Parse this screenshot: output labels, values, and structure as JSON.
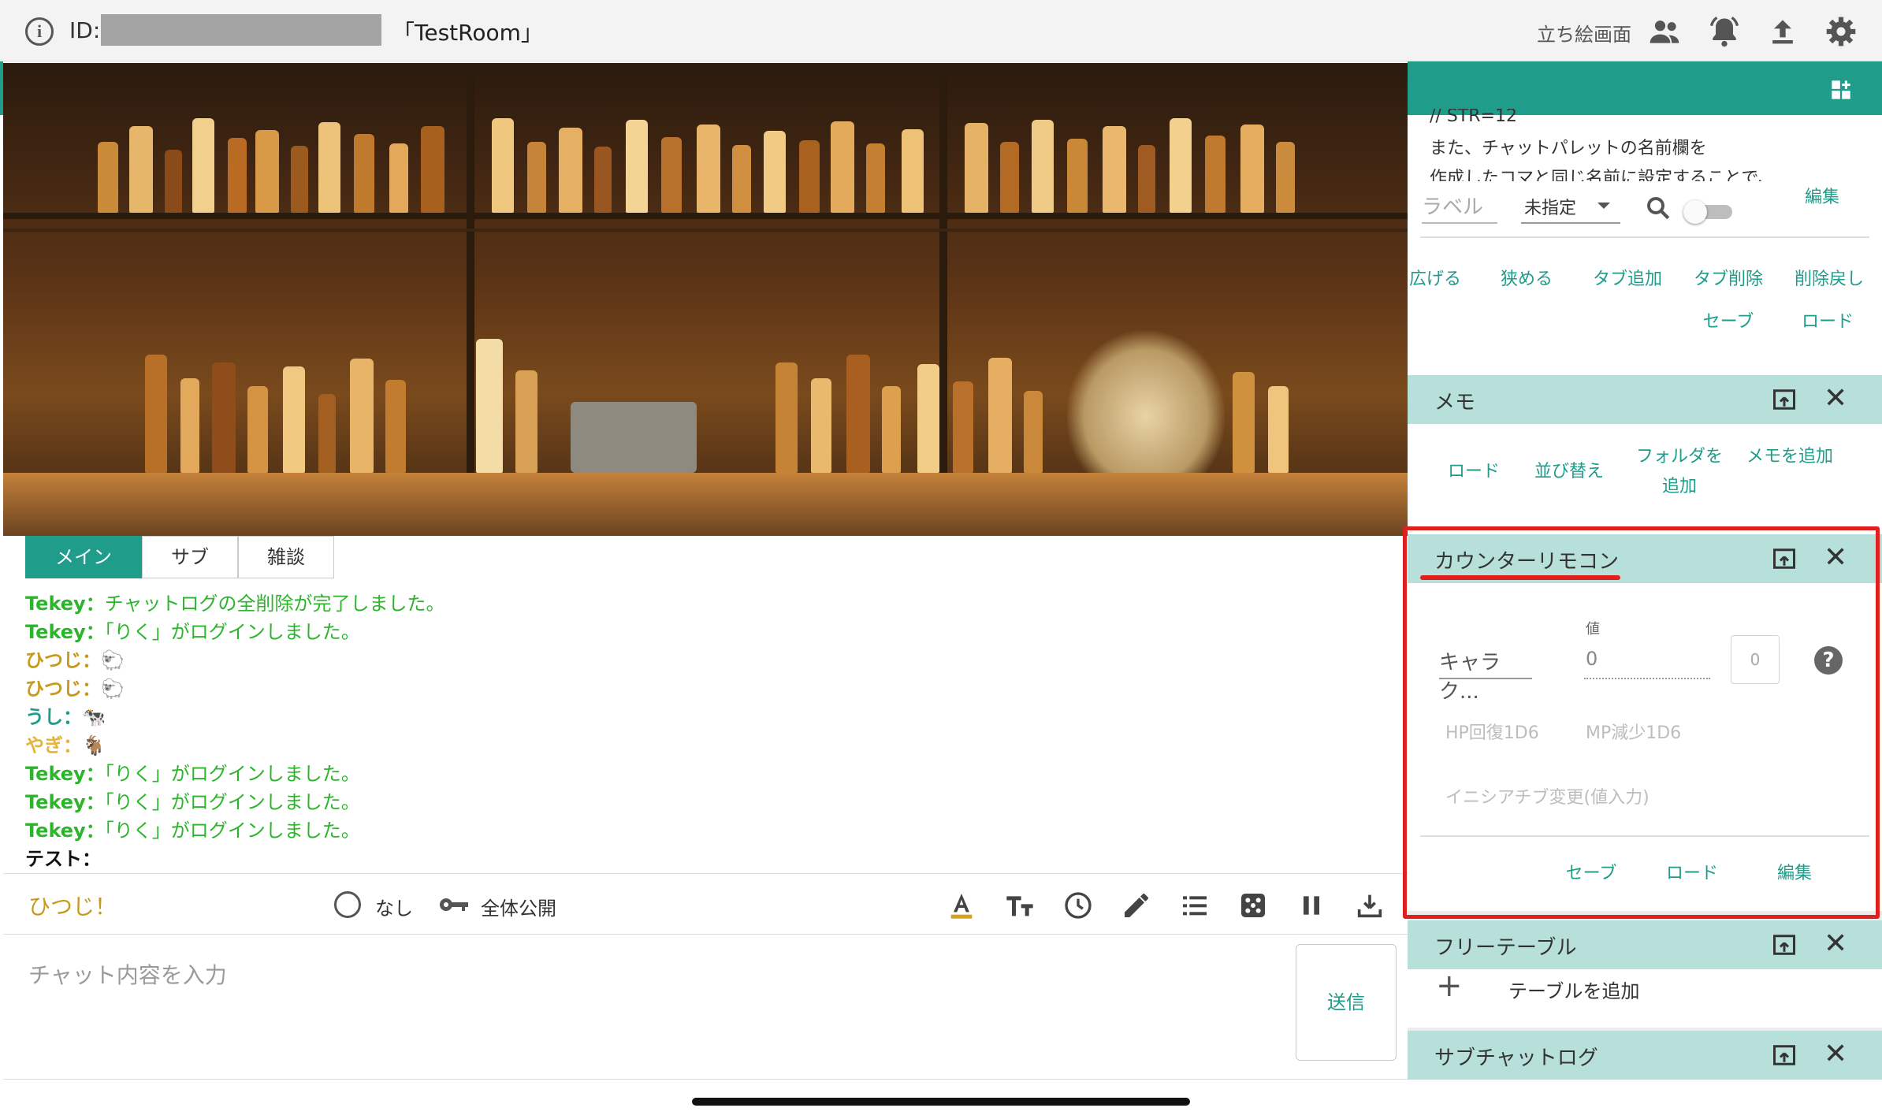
{
  "header": {
    "id_label": "ID:",
    "room_name": "「TestRoom」",
    "standing_label": "立ち絵画面",
    "icons": [
      "people-icon",
      "bell-icon",
      "upload-icon",
      "gear-icon"
    ]
  },
  "tabs": [
    {
      "label": "メイン",
      "active": true
    },
    {
      "label": "サブ",
      "active": false
    },
    {
      "label": "雑談",
      "active": false
    }
  ],
  "chat_lines": [
    {
      "speaker": "Tekey：",
      "text": "チャットログの全削除が完了しました。",
      "color": "#2bb52b"
    },
    {
      "speaker": "Tekey：",
      "text": "「りく」がログインしました。",
      "color": "#2bb52b"
    },
    {
      "speaker": "ひつじ：",
      "text": "🐑",
      "color": "#c79a19"
    },
    {
      "speaker": "ひつじ：",
      "text": "🐑",
      "color": "#c79a19"
    },
    {
      "speaker": "うし：",
      "text": "🐄",
      "color": "#1f9c8a"
    },
    {
      "speaker": "やぎ：",
      "text": "🐐",
      "color": "#e8b33a"
    },
    {
      "speaker": "Tekey：",
      "text": "「りく」がログインしました。",
      "color": "#2bb52b"
    },
    {
      "speaker": "Tekey：",
      "text": "「りく」がログインしました。",
      "color": "#2bb52b"
    },
    {
      "speaker": "Tekey：",
      "text": "「りく」がログインしました。",
      "color": "#2bb52b"
    },
    {
      "speaker": "テスト：",
      "text": "",
      "color": "#111111"
    }
  ],
  "input_bar": {
    "sender": "ひつじ！",
    "face_label": "なし",
    "visibility_label": "全体公開",
    "tools": [
      "font-color-icon",
      "text-size-icon",
      "clock-icon",
      "pencil-icon",
      "list-icon",
      "dice-icon",
      "pause-icon",
      "download-icon"
    ]
  },
  "chat_input": {
    "placeholder": "チャット内容を入力",
    "send_label": "送信"
  },
  "side": {
    "palette": {
      "text_line_0": "// STR=12",
      "text_line_1": "また、チャットパレットの名前欄を",
      "text_line_2": "作成したコマと同じ名前に設定することで、",
      "label_placeholder": "ラベル",
      "select_value": "未指定",
      "edit_label": "編集",
      "buttons_row1": [
        "広げる",
        "狭める",
        "タブ追加",
        "タブ削除",
        "削除戻し"
      ],
      "buttons_row2": [
        "セーブ",
        "ロード"
      ]
    },
    "memo": {
      "title": "メモ",
      "buttons": [
        "ロード",
        "並び替え",
        "フォルダを追加",
        "メモを追加"
      ]
    },
    "counter": {
      "title": "カウンターリモコン",
      "char_placeholder": "キャラク...",
      "value_label": "値",
      "value": "0",
      "counter_box": "0",
      "help": "?",
      "chips": [
        "HP回復1D6",
        "MP減少1D6",
        "イニシアチブ変更(値入力)"
      ],
      "buttons": [
        "セーブ",
        "ロード",
        "編集"
      ]
    },
    "free_table": {
      "title": "フリーテーブル",
      "add_label": "テーブルを追加"
    },
    "sub_chat": {
      "title": "サブチャットログ"
    }
  },
  "colors": {
    "accent": "#1f9c8a",
    "panel_header": "#b7e0da",
    "highlight": "#e0201f"
  }
}
